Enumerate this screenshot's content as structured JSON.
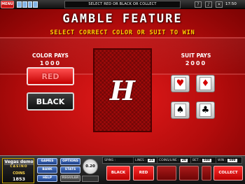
{
  "topbar": {
    "menu_label": "MENU",
    "message": "SELECT RED OR BLACK OR COLLECT",
    "clock": "17:50",
    "icons": [
      "help-icon",
      "sound-icon",
      "close-icon"
    ]
  },
  "game": {
    "title": "GAMBLE FEATURE",
    "subtitle": "SELECT CORRECT COLOR OR SUIT TO WIN",
    "color_pays_label": "COLOR PAYS",
    "color_pays_value": "1000",
    "suit_pays_label": "SUIT PAYS",
    "suit_pays_value": "2000",
    "red_label": "RED",
    "black_label": "BLACK",
    "card_letter": "H",
    "suits": [
      {
        "name": "hearts",
        "glyph": "♥",
        "color": "#d40000"
      },
      {
        "name": "diamonds",
        "glyph": "♦",
        "color": "#d40000"
      },
      {
        "name": "spades",
        "glyph": "♠",
        "color": "#000000"
      },
      {
        "name": "clubs",
        "glyph": "♣",
        "color": "#000000"
      }
    ]
  },
  "panel": {
    "logo_name": "Vegas",
    "logo_name_2": "demo",
    "logo_sub": "CASINO",
    "coins_label": "COINS",
    "coins_value": "1853",
    "buttons": {
      "games": "GAMES",
      "options": "OPTIONS",
      "bank": "BANK",
      "stats": "STATS",
      "help": "HELP",
      "regular": "REGULAR"
    },
    "coin_value": "0.20",
    "coin_small_label": "",
    "stats": {
      "spins_label": "SPINS :",
      "spins_value": "",
      "lines_label": "LINES :",
      "lines_value": "25",
      "coins_line_label": "COINS/LINE :",
      "coins_line_value": "20",
      "bet_label": "BET :",
      "bet_value": "500",
      "win_label": "WIN :",
      "win_value": "500"
    },
    "actions": {
      "black": "BLACK",
      "red": "RED",
      "collect": "COLLECT"
    }
  }
}
